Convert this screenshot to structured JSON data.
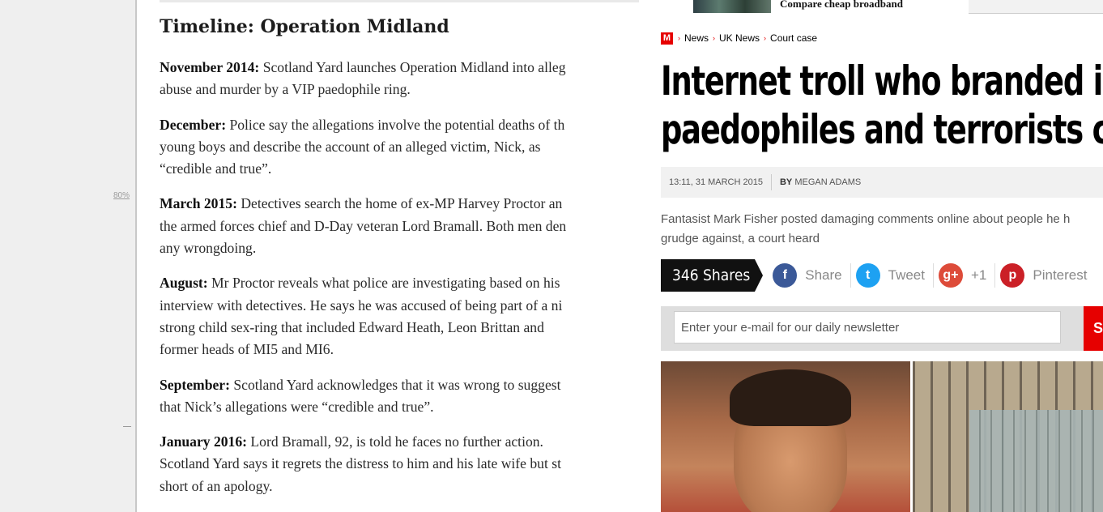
{
  "left_panel": {
    "zoom_label": "80%",
    "heading": "Timeline: Operation Midland",
    "entries": [
      {
        "date": "November 2014:",
        "lines": [
          " Scotland Yard launches Operation Midland into alleg",
          "abuse and murder by a VIP paedophile ring."
        ]
      },
      {
        "date": "December:",
        "lines": [
          " Police say the allegations involve the potential deaths of th",
          "young boys and describe the account of an alleged victim, Nick, as",
          "“credible and true”."
        ]
      },
      {
        "date": "March 2015:",
        "lines": [
          " Detectives search the home of ex-MP Harvey Proctor an",
          "the armed forces chief and D-Day veteran Lord Bramall. Both men den",
          "any wrongdoing."
        ]
      },
      {
        "date": "August:",
        "lines": [
          " Mr Proctor reveals what police are investigating based on his",
          "interview with detectives. He says he was accused of being part of a ni",
          "strong child sex-ring that included Edward Heath, Leon Brittan and",
          "former heads of MI5 and MI6."
        ]
      },
      {
        "date": "September:",
        "lines": [
          " Scotland Yard acknowledges that it was wrong to suggest",
          "that Nick’s allegations were “credible and true”."
        ]
      },
      {
        "date": "January 2016:",
        "lines": [
          " Lord Bramall, 92, is told he faces no further action.",
          "Scotland Yard says it regrets the distress to him and his late wife but st",
          "short of an apology."
        ]
      }
    ]
  },
  "right_panel": {
    "promo_text": "Compare cheap broadband",
    "logo_letter": "M",
    "breadcrumbs": [
      "News",
      "UK News",
      "Court case"
    ],
    "headline_lines": [
      "Internet troll who branded inno",
      "paedophiles and terrorists conv"
    ],
    "timestamp": "13:11, 31 MARCH 2015",
    "byline_prefix": "BY",
    "author": "MEGAN ADAMS",
    "standfirst_lines": [
      "Fantasist Mark Fisher posted damaging comments online about people he h",
      "grudge against, a court heard"
    ],
    "share_count": "346 Shares",
    "share_buttons": [
      {
        "icon": "facebook-icon",
        "glyph": "f",
        "label": "Share",
        "color": "#3b5998"
      },
      {
        "icon": "twitter-icon",
        "glyph": "t",
        "label": "Tweet",
        "color": "#1da1f2"
      },
      {
        "icon": "google-plus-icon",
        "glyph": "g+",
        "label": "+1",
        "color": "#dd4b39"
      },
      {
        "icon": "pinterest-icon",
        "glyph": "p",
        "label": "Pinterest",
        "color": "#cb2027"
      }
    ],
    "newsletter_placeholder": "Enter your e-mail for our daily newsletter",
    "newsletter_button": "S"
  },
  "colors": {
    "brand_red": "#e60000",
    "headline": "#000000",
    "meta_bg": "#f1f1f1"
  }
}
